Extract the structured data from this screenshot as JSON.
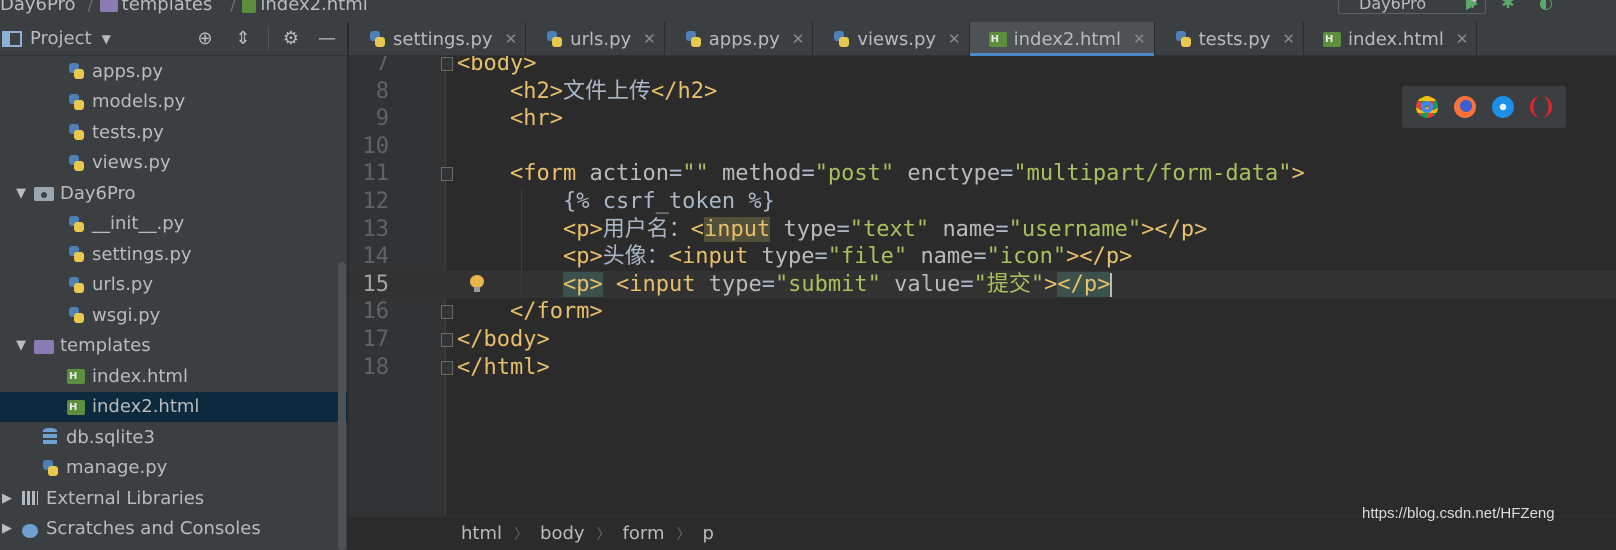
{
  "nav": {
    "crumbs": [
      "Day6Pro",
      "templates",
      "index2.html"
    ],
    "run_config": "Day6Pro"
  },
  "sidebar": {
    "title": "Project",
    "items": [
      {
        "label": "apps.py",
        "icon": "python-file-icon",
        "depth": 3
      },
      {
        "label": "models.py",
        "icon": "python-file-icon",
        "depth": 3
      },
      {
        "label": "tests.py",
        "icon": "python-file-icon",
        "depth": 3
      },
      {
        "label": "views.py",
        "icon": "python-file-icon",
        "depth": 3
      },
      {
        "label": "Day6Pro",
        "icon": "package-folder-icon",
        "depth": 1,
        "expanded": true
      },
      {
        "label": "__init__.py",
        "icon": "python-file-icon",
        "depth": 3
      },
      {
        "label": "settings.py",
        "icon": "python-file-icon",
        "depth": 3
      },
      {
        "label": "urls.py",
        "icon": "python-file-icon",
        "depth": 3
      },
      {
        "label": "wsgi.py",
        "icon": "python-file-icon",
        "depth": 3
      },
      {
        "label": "templates",
        "icon": "folder-icon",
        "depth": 1,
        "expanded": true
      },
      {
        "label": "index.html",
        "icon": "html-file-icon",
        "depth": 3
      },
      {
        "label": "index2.html",
        "icon": "html-file-icon",
        "depth": 3,
        "selected": true
      },
      {
        "label": "db.sqlite3",
        "icon": "database-icon",
        "depth": 2
      },
      {
        "label": "manage.py",
        "icon": "python-file-icon",
        "depth": 2
      },
      {
        "label": "External Libraries",
        "icon": "libraries-icon",
        "depth": 0
      },
      {
        "label": "Scratches and Consoles",
        "icon": "scratches-icon",
        "depth": 0
      }
    ]
  },
  "tabs": [
    {
      "label": "settings.py",
      "icon": "python-file-icon"
    },
    {
      "label": "urls.py",
      "icon": "python-file-icon"
    },
    {
      "label": "apps.py",
      "icon": "python-file-icon"
    },
    {
      "label": "views.py",
      "icon": "python-file-icon"
    },
    {
      "label": "index2.html",
      "icon": "html-file-icon",
      "active": true
    },
    {
      "label": "tests.py",
      "icon": "python-file-icon"
    },
    {
      "label": "index.html",
      "icon": "html-file-icon"
    }
  ],
  "editor": {
    "current_line": "15",
    "lines": [
      {
        "num": "7",
        "text": "<body>"
      },
      {
        "num": "8",
        "text": "    <h2>文件上传</h2>"
      },
      {
        "num": "9",
        "text": "    <hr>"
      },
      {
        "num": "10",
        "text": ""
      },
      {
        "num": "11",
        "text": "    <form action=\"\" method=\"post\" enctype=\"multipart/form-data\">"
      },
      {
        "num": "12",
        "text": "        {% csrf_token %}"
      },
      {
        "num": "13",
        "text": "        <p>用户名：<input type=\"text\" name=\"username\"></p>"
      },
      {
        "num": "14",
        "text": "        <p>头像：<input type=\"file\" name=\"icon\"></p>"
      },
      {
        "num": "15",
        "text": "        <p> <input type=\"submit\" value=\"提交\"></p>"
      },
      {
        "num": "16",
        "text": "    </form>"
      },
      {
        "num": "17",
        "text": "</body>"
      },
      {
        "num": "18",
        "text": "</html>"
      }
    ]
  },
  "breadcrumb": [
    "html",
    "body",
    "form",
    "p"
  ],
  "browser_popup": [
    "chrome-icon",
    "firefox-icon",
    "safari-icon",
    "opera-icon"
  ],
  "watermark": "https://blog.csdn.net/HFZeng"
}
